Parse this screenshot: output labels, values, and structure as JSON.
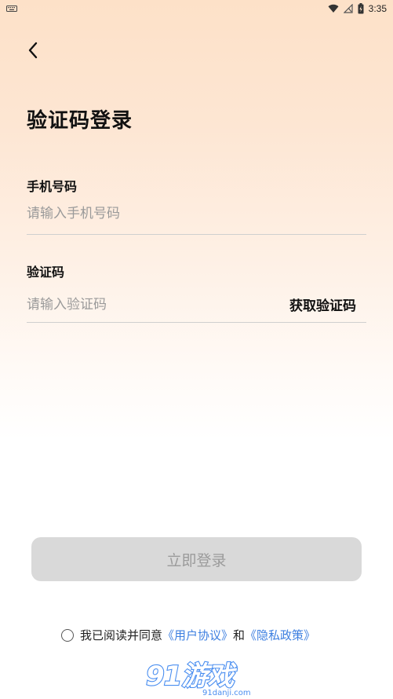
{
  "status_bar": {
    "time": "3:35",
    "icons": [
      "keyboard-icon",
      "wifi-icon",
      "no-signal-icon",
      "battery-charging-icon"
    ]
  },
  "header": {
    "back_icon": "chevron-left-icon"
  },
  "page": {
    "title": "验证码登录"
  },
  "form": {
    "phone": {
      "label": "手机号码",
      "placeholder": "请输入手机号码",
      "value": ""
    },
    "code": {
      "label": "验证码",
      "placeholder": "请输入验证码",
      "value": "",
      "get_code_label": "获取验证码"
    },
    "login_label": "立即登录"
  },
  "agreement": {
    "checked": false,
    "text_prefix": "我已阅读并同意",
    "user_agreement": "《用户协议》",
    "connector": "和",
    "privacy_policy": "《隐私政策》"
  },
  "watermark": {
    "main": "91游戏",
    "sub": "91danji.com"
  },
  "colors": {
    "accent_link": "#3d7fe0",
    "button_disabled_bg": "#d9d9d9",
    "button_disabled_text": "#9b9b9b",
    "gradient_top": "#fde1c8",
    "watermark_blue": "#4a8ef0"
  }
}
